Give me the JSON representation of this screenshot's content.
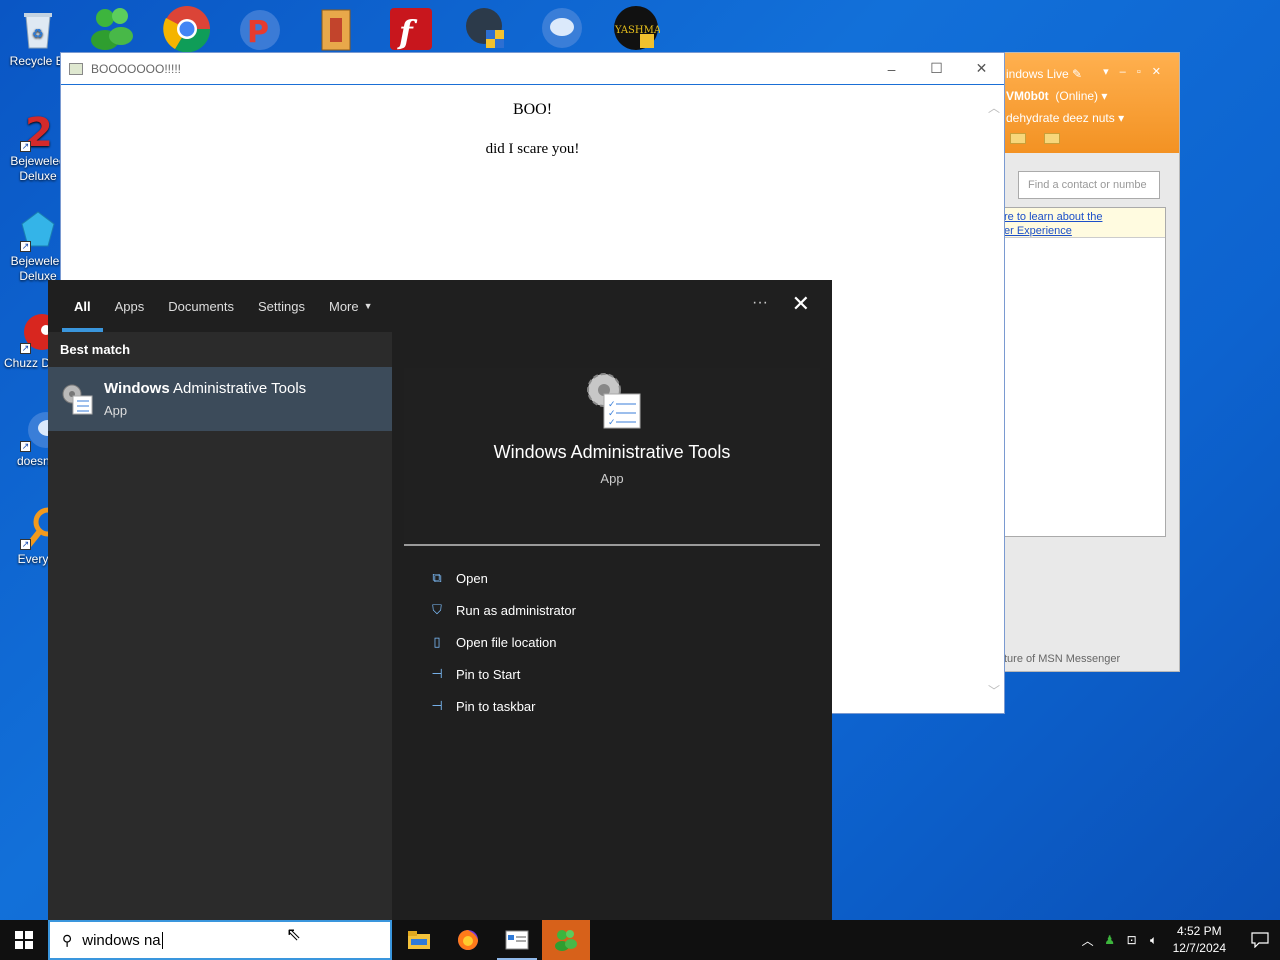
{
  "desktop": {
    "icons": [
      {
        "label": "Recycle Bi",
        "icon": "recycle-bin-icon"
      },
      {
        "label": "Bejeweled Deluxe",
        "icon": "bejeweled-2-icon"
      },
      {
        "label": "Bejewelec Deluxe",
        "icon": "bejeweled-icon"
      },
      {
        "label": "Chuzz Delux",
        "icon": "chuzzle-icon"
      },
      {
        "label": "doesnt l",
        "icon": "messenger-icon"
      },
      {
        "label": "Everyth",
        "icon": "everything-search-icon"
      }
    ],
    "top_icons": [
      "msn-messenger-icon",
      "chrome-icon",
      "pinball-icon",
      "archive-icon",
      "flash-icon",
      "windows-guard-icon",
      "messenger-live-icon",
      "yashma-icon"
    ],
    "yashma_label": "YASHMA"
  },
  "boo_window": {
    "title": "BOOOOOOO!!!!!",
    "heading": "BOO!",
    "text": "did I scare you!"
  },
  "msn_window": {
    "brand": "indows Live",
    "user": "VM0b0t",
    "status": "(Online)",
    "message": "dehydrate deez nuts",
    "search_placeholder": "Find a contact or numbe",
    "link_line1": "re to learn about the",
    "link_line2": "er Experience",
    "footer": "ture of MSN Messenger"
  },
  "search_panel": {
    "tabs": [
      "All",
      "Apps",
      "Documents",
      "Settings",
      "More"
    ],
    "active_tab": "All",
    "section_label": "Best match",
    "result": {
      "name_bold": "Windows",
      "name_rest": " Administrative Tools",
      "type": "App"
    },
    "detail": {
      "title": "Windows Administrative Tools",
      "type": "App"
    },
    "actions": [
      {
        "label": "Open",
        "icon": "open-icon"
      },
      {
        "label": "Run as administrator",
        "icon": "shield-admin-icon"
      },
      {
        "label": "Open file location",
        "icon": "file-location-icon"
      },
      {
        "label": "Pin to Start",
        "icon": "pin-icon"
      },
      {
        "label": "Pin to taskbar",
        "icon": "pin-icon"
      }
    ]
  },
  "taskbar": {
    "search_value": "windows na",
    "clock_time": "4:52 PM",
    "clock_date": "12/7/2024",
    "apps": [
      "file-explorer-icon",
      "firefox-icon",
      "browser-window-icon",
      "msn-messenger-icon"
    ]
  },
  "colors": {
    "accent": "#3a96dd",
    "active_app": "#d7611a",
    "msn_orange": "#f39223"
  }
}
